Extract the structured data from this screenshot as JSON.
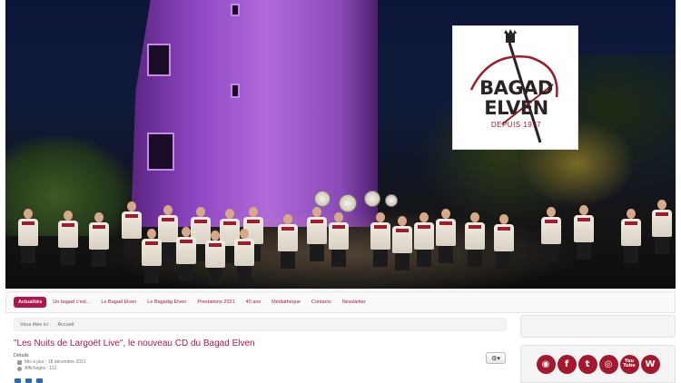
{
  "hero": {
    "logo": {
      "line1": "BAGAD",
      "line2": "ELVEN",
      "subtitle": "DEPUIS 1977",
      "accent_color": "#9a1e2e"
    }
  },
  "nav": {
    "items": [
      {
        "label": "Actualités",
        "active": true
      },
      {
        "label": "Un bagad c'est...",
        "active": false
      },
      {
        "label": "Le Bagad Elven",
        "active": false
      },
      {
        "label": "Le Bagadig Elven",
        "active": false
      },
      {
        "label": "Prestations 2021",
        "active": false
      },
      {
        "label": "40 ans",
        "active": false
      },
      {
        "label": "Médiathèque",
        "active": false
      },
      {
        "label": "Contacts",
        "active": false
      },
      {
        "label": "Newsletter",
        "active": false
      }
    ],
    "accent_color": "#b0164e"
  },
  "breadcrumb": {
    "prefix": "Vous êtes ici :",
    "current": "Accueil"
  },
  "article": {
    "title": "\"Les Nuits de Largoët Live\", le nouveau CD du Bagad Elven",
    "details_label": "Détails",
    "updated": "Mis à jour : 18 décembre 2021",
    "views": "Affichages : 112",
    "tools_icon": "gear-icon"
  },
  "sidebar": {
    "social_icons": [
      {
        "name": "rss-icon",
        "glyph": "◉"
      },
      {
        "name": "facebook-icon",
        "glyph": "f"
      },
      {
        "name": "twitter-icon",
        "glyph": "t"
      },
      {
        "name": "instagram-icon",
        "glyph": "◎"
      },
      {
        "name": "youtube-icon",
        "glyph": "You\nTube"
      },
      {
        "name": "wikipedia-icon",
        "glyph": "W"
      }
    ],
    "icon_color": "#a3172f"
  }
}
